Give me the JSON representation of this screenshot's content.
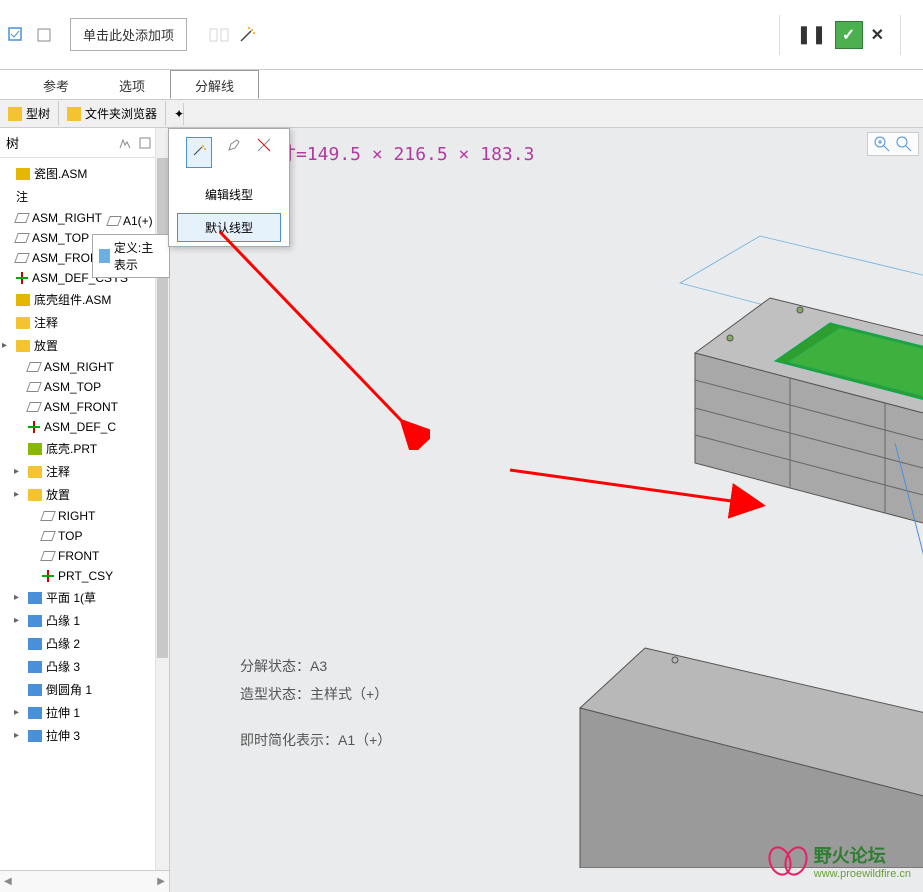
{
  "toolbar": {
    "add_item_placeholder": "单击此处添加项"
  },
  "tabs": {
    "reference": "参考",
    "options": "选项",
    "explode_line": "分解线"
  },
  "inner_tabs": {
    "model_tree": "型树",
    "folder_browser": "文件夹浏览器"
  },
  "tree": {
    "header": "树",
    "items": [
      {
        "label": "瓷图.ASM",
        "icon": "asm",
        "indent": 0
      },
      {
        "label": "注",
        "icon": "",
        "indent": 0
      },
      {
        "label": "ASM_RIGHT",
        "icon": "plane",
        "indent": 0
      },
      {
        "label": "ASM_TOP",
        "icon": "plane",
        "indent": 0
      },
      {
        "label": "ASM_FRONT",
        "icon": "plane",
        "indent": 0
      },
      {
        "label": "ASM_DEF_CSYS",
        "icon": "csys",
        "indent": 0
      },
      {
        "label": "底壳组件.ASM",
        "icon": "asm",
        "indent": 0
      },
      {
        "label": "注释",
        "icon": "folder",
        "indent": 0
      },
      {
        "label": "放置",
        "icon": "folder",
        "indent": 0,
        "expand": "▸"
      },
      {
        "label": "ASM_RIGHT",
        "icon": "plane",
        "indent": 1
      },
      {
        "label": "ASM_TOP",
        "icon": "plane",
        "indent": 1
      },
      {
        "label": "ASM_FRONT",
        "icon": "plane",
        "indent": 1
      },
      {
        "label": "ASM_DEF_C",
        "icon": "csys",
        "indent": 1
      },
      {
        "label": "底壳.PRT",
        "icon": "prt",
        "indent": 1
      },
      {
        "label": "注释",
        "icon": "folder",
        "indent": 1,
        "expand": "▸"
      },
      {
        "label": "放置",
        "icon": "folder",
        "indent": 1,
        "expand": "▸"
      },
      {
        "label": "RIGHT",
        "icon": "plane",
        "indent": 2
      },
      {
        "label": "TOP",
        "icon": "plane",
        "indent": 2
      },
      {
        "label": "FRONT",
        "icon": "plane",
        "indent": 2
      },
      {
        "label": "PRT_CSY",
        "icon": "csys",
        "indent": 2
      },
      {
        "label": "平面 1(草",
        "icon": "feat",
        "indent": 1,
        "expand": "▸"
      },
      {
        "label": "凸缘 1",
        "icon": "feat",
        "indent": 1,
        "expand": "▸"
      },
      {
        "label": "凸缘 2",
        "icon": "feat",
        "indent": 1
      },
      {
        "label": "凸缘 3",
        "icon": "feat",
        "indent": 1
      },
      {
        "label": "倒圆角 1",
        "icon": "feat",
        "indent": 1
      },
      {
        "label": "拉伸 1",
        "icon": "feat",
        "indent": 1,
        "expand": "▸"
      },
      {
        "label": "拉伸 3",
        "icon": "feat",
        "indent": 1,
        "expand": "▸"
      }
    ]
  },
  "popup": {
    "edit_line_type": "编辑线型",
    "default_line_type": "默认线型"
  },
  "secondary": {
    "label": "定义:主表示",
    "a1": "A1(+)"
  },
  "viewport": {
    "dimensions": "寸=149.5 × 216.5 × 183.3",
    "status_line1": "分解状态：A3",
    "status_line2": "造型状态：主样式（+）",
    "status_line3": "即时简化表示：A1（+）"
  },
  "watermark": {
    "title": "野火论坛",
    "url": "www.proewildfire.cn"
  }
}
